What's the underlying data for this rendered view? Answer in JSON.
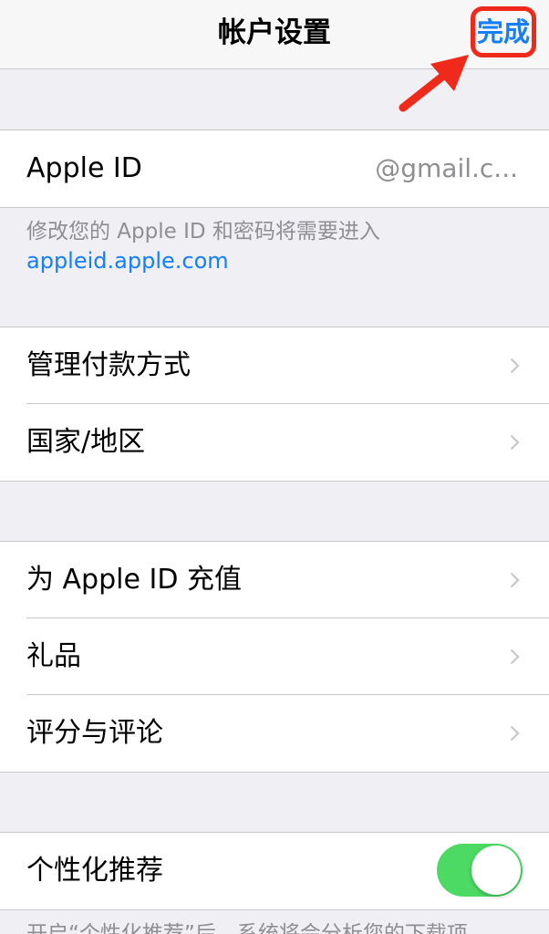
{
  "navbar": {
    "title": "帐户设置",
    "done_label": "完成"
  },
  "apple_id": {
    "label": "Apple ID",
    "value": "@gmail.c..."
  },
  "apple_id_note": {
    "text": "修改您的 Apple ID 和密码将需要进入",
    "link": "appleid.apple.com"
  },
  "payment_group": {
    "items": [
      {
        "label": "管理付款方式"
      },
      {
        "label": "国家/地区"
      }
    ]
  },
  "store_group": {
    "items": [
      {
        "label": "为 Apple ID 充值"
      },
      {
        "label": "礼品"
      },
      {
        "label": "评分与评论"
      }
    ]
  },
  "personalization": {
    "label": "个性化推荐",
    "toggle_on": true,
    "note": "开启“个性化推荐”后，系统将会分析您的下载项"
  },
  "colors": {
    "accent": "#157efb",
    "toggle_on": "#4cd964",
    "annotation": "#f02a1b"
  }
}
